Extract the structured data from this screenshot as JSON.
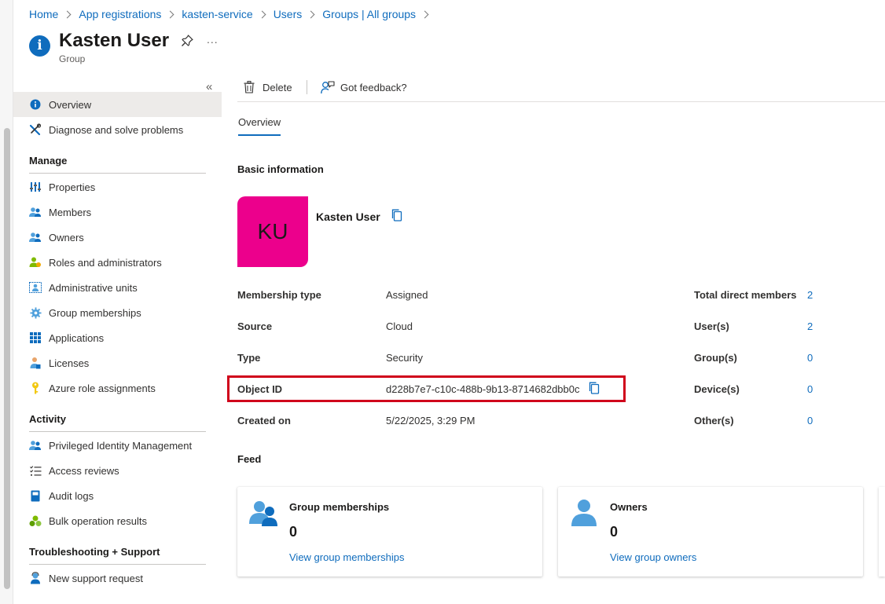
{
  "breadcrumb": [
    "Home",
    "App registrations",
    "kasten-service",
    "Users",
    "Groups | All groups"
  ],
  "header": {
    "title": "Kasten User",
    "subtitle": "Group",
    "more": "..."
  },
  "sidebar": {
    "collapse": "«",
    "top_items": [
      {
        "label": "Overview",
        "icon": "info-icon"
      },
      {
        "label": "Diagnose and solve problems",
        "icon": "wrench-icon"
      }
    ],
    "sections": [
      {
        "title": "Manage",
        "items": [
          {
            "label": "Properties",
            "icon": "properties-icon"
          },
          {
            "label": "Members",
            "icon": "members-icon"
          },
          {
            "label": "Owners",
            "icon": "owners-icon"
          },
          {
            "label": "Roles and administrators",
            "icon": "roles-icon"
          },
          {
            "label": "Administrative units",
            "icon": "admin-units-icon"
          },
          {
            "label": "Group memberships",
            "icon": "gear-icon"
          },
          {
            "label": "Applications",
            "icon": "grid-icon"
          },
          {
            "label": "Licenses",
            "icon": "license-icon"
          },
          {
            "label": "Azure role assignments",
            "icon": "key-icon"
          }
        ]
      },
      {
        "title": "Activity",
        "items": [
          {
            "label": "Privileged Identity Management",
            "icon": "pim-icon"
          },
          {
            "label": "Access reviews",
            "icon": "checklist-icon"
          },
          {
            "label": "Audit logs",
            "icon": "book-icon"
          },
          {
            "label": "Bulk operation results",
            "icon": "bulk-icon"
          }
        ]
      },
      {
        "title": "Troubleshooting + Support",
        "items": [
          {
            "label": "New support request",
            "icon": "support-icon"
          }
        ]
      }
    ]
  },
  "toolbar": {
    "delete": "Delete",
    "feedback": "Got feedback?"
  },
  "tabs": {
    "overview": "Overview"
  },
  "basic_info": {
    "title": "Basic information",
    "avatar_initials": "KU",
    "name": "Kasten User",
    "properties": [
      {
        "label": "Membership type",
        "value": "Assigned"
      },
      {
        "label": "Source",
        "value": "Cloud"
      },
      {
        "label": "Type",
        "value": "Security"
      },
      {
        "label": "Object ID",
        "value": "d228b7e7-c10c-488b-9b13-8714682dbb0c"
      },
      {
        "label": "Created on",
        "value": "5/22/2025, 3:29 PM"
      }
    ],
    "counts": [
      {
        "label": "Total direct members",
        "value": "2"
      },
      {
        "label": "User(s)",
        "value": "2"
      },
      {
        "label": "Group(s)",
        "value": "0"
      },
      {
        "label": "Device(s)",
        "value": "0"
      },
      {
        "label": "Other(s)",
        "value": "0"
      }
    ]
  },
  "feed": {
    "title": "Feed",
    "cards": [
      {
        "title": "Group memberships",
        "count": "0",
        "link": "View group memberships",
        "icon": "group-icon"
      },
      {
        "title": "Owners",
        "count": "0",
        "link": "View group owners",
        "icon": "person-icon"
      }
    ]
  },
  "colors": {
    "accent": "#0f6cbd",
    "avatar": "#ec008c",
    "highlight": "#d0021b"
  }
}
